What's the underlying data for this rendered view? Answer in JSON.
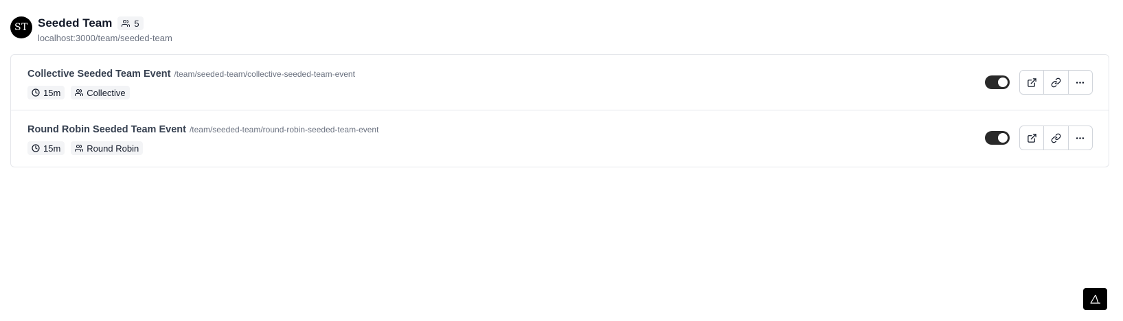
{
  "team": {
    "avatar_initials": "ST",
    "name": "Seeded Team",
    "member_count": "5",
    "url": "localhost:3000/team/seeded-team"
  },
  "events": [
    {
      "title": "Collective Seeded Team Event",
      "slug": "/team/seeded-team/collective-seeded-team-event",
      "duration": "15m",
      "scheduling_type": "Collective",
      "enabled": true
    },
    {
      "title": "Round Robin Seeded Team Event",
      "slug": "/team/seeded-team/round-robin-seeded-team-event",
      "duration": "15m",
      "scheduling_type": "Round Robin",
      "enabled": true
    }
  ],
  "icons": {
    "members": "users-icon",
    "duration": "clock-icon",
    "scheduling": "users-icon",
    "preview": "external-link-icon",
    "copy": "link-icon",
    "more": "more-horizontal-icon",
    "help": "help-triangle-icon"
  },
  "colors": {
    "toggle_on": "#292929",
    "badge_bg": "#f3f4f6",
    "border": "#e5e7eb"
  }
}
